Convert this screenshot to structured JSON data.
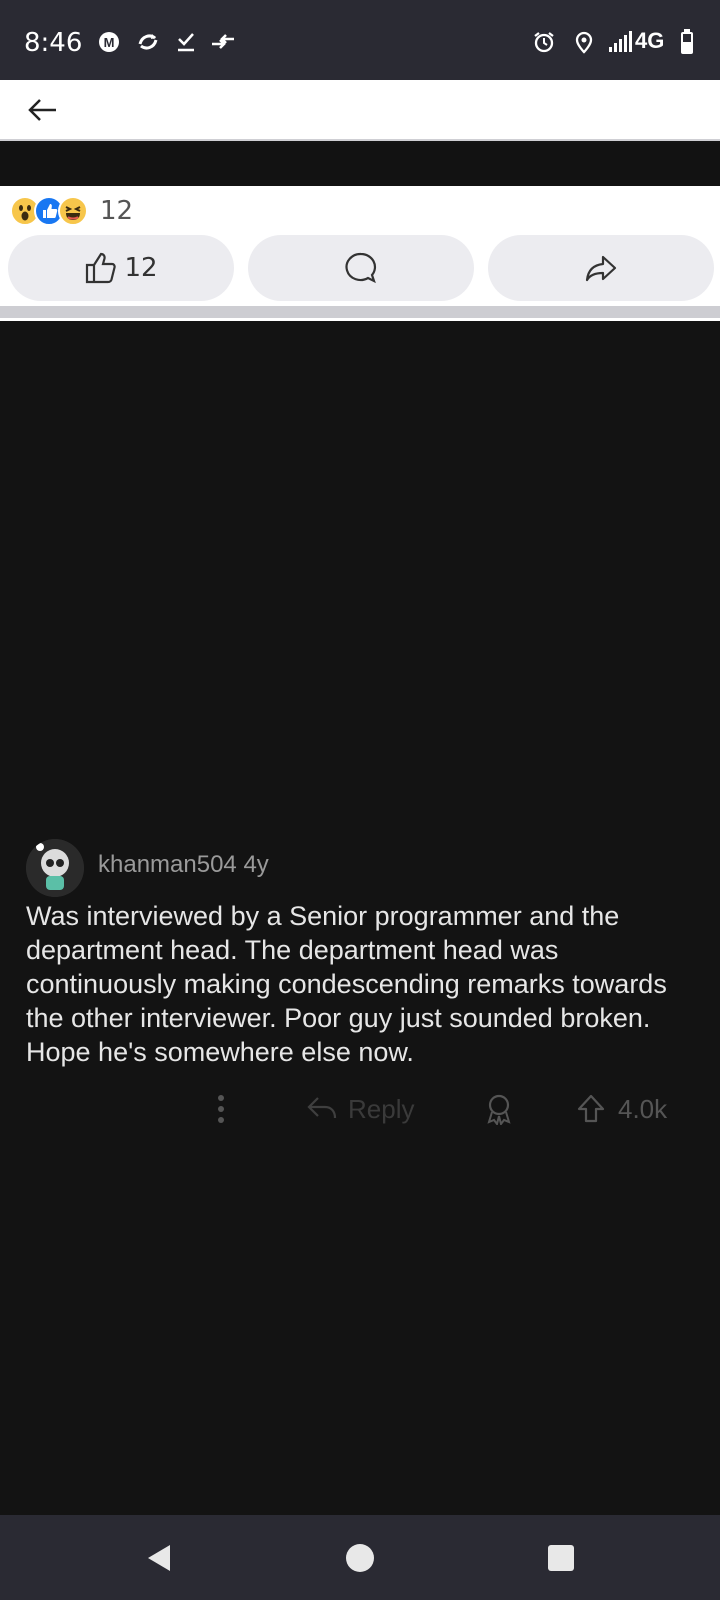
{
  "status_bar": {
    "time": "8:46",
    "network": "4G",
    "left_icons": [
      "m-icon",
      "sync-icon",
      "check-icon",
      "transfer-icon"
    ],
    "right_icons": [
      "alarm-icon",
      "location-icon",
      "signal-icon",
      "battery-icon"
    ]
  },
  "app_bar": {
    "back_icon": "back-arrow-icon"
  },
  "post": {
    "reaction_icons": [
      "wow-emoji-icon",
      "like-emoji-icon",
      "haha-emoji-icon"
    ],
    "reaction_count": "12",
    "like_count": "12",
    "actions": [
      "like-icon",
      "comment-icon",
      "share-icon"
    ]
  },
  "comment": {
    "username": "khanman504",
    "age": "4y",
    "text": "Was interviewed by a Senior programmer and the department head. The department head was continuously making condescending remarks towards the other interviewer. Poor guy just sounded broken. Hope he's somewhere else now.",
    "reply_label": "Reply",
    "upvotes": "4.0k"
  },
  "colors": {
    "status_bar_bg": "#2a2a33",
    "comment_bg": "#131313",
    "reaction_like_blue": "#1877f2",
    "reaction_emoji_yellow": "#f7c64b"
  }
}
